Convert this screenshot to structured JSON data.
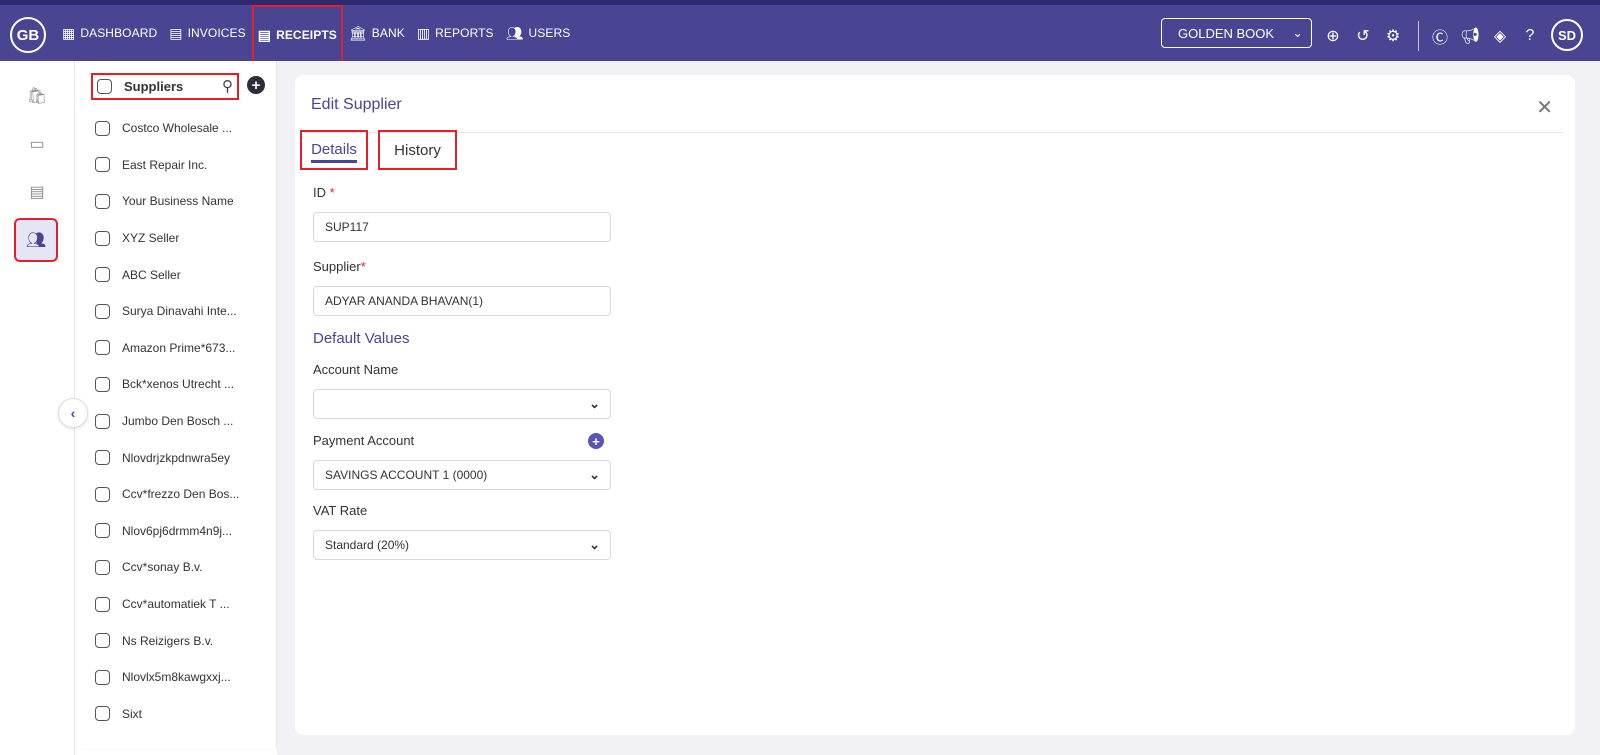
{
  "app": {
    "logo_text": "GB",
    "avatar_initials": "SD",
    "book_select": "GOLDEN BOOK",
    "brand_color": "#4a4592",
    "highlight_color": "#e0202a"
  },
  "nav": {
    "items": [
      {
        "label": "DASHBOARD",
        "icon": "grid-icon"
      },
      {
        "label": "INVOICES",
        "icon": "invoice-icon"
      },
      {
        "label": "RECEIPTS",
        "icon": "receipt-icon",
        "active": true
      },
      {
        "label": "BANK",
        "icon": "bank-icon"
      },
      {
        "label": "REPORTS",
        "icon": "reports-icon"
      },
      {
        "label": "USERS",
        "icon": "users-icon"
      }
    ]
  },
  "topbar_icons": [
    "add-circle-icon",
    "history-icon",
    "settings-gear-icon",
    "c-logo-icon",
    "megaphone-icon",
    "diamond-icon",
    "help-icon"
  ],
  "rail_icons": [
    "bag-icon",
    "inbox-icon",
    "card-check-icon",
    "people-icon"
  ],
  "suppliers_panel": {
    "title": "Suppliers",
    "items": [
      "Costco Wholesale ...",
      "East Repair Inc.",
      "Your Business Name",
      "XYZ Seller",
      "ABC Seller",
      "Surya Dinavahi Inte...",
      "Amazon Prime*673...",
      "Bck*xenos Utrecht ...",
      "Jumbo Den Bosch ...",
      "Nlovdrjzkpdnwra5ey",
      "Ccv*frezzo Den Bos...",
      "Nlov6pj6drmm4n9j...",
      "Ccv*sonay B.v.",
      "Ccv*automatiek T ...",
      "Ns Reizigers B.v.",
      "Nlovlx5m8kawgxxj...",
      "Sixt"
    ]
  },
  "edit": {
    "title": "Edit Supplier",
    "tabs": [
      "Details",
      "History"
    ],
    "id_label": "ID",
    "id_value": "SUP117",
    "supplier_label": "Supplier",
    "supplier_value": "ADYAR ANANDA BHAVAN(1)",
    "required_mark": "*",
    "section_title": "Default Values",
    "account_name_label": "Account Name",
    "account_name_value": "",
    "payment_account_label": "Payment Account",
    "payment_account_value": "SAVINGS ACCOUNT 1 (0000)",
    "vat_rate_label": "VAT Rate",
    "vat_rate_value": "Standard (20%)"
  }
}
